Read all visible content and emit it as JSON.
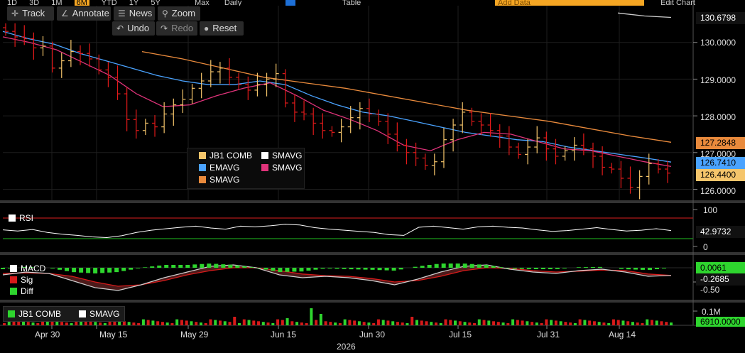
{
  "toolbar": {
    "track": "Track",
    "annotate": "Annotate",
    "news": "News",
    "zoom": "Zoom",
    "undo": "Undo",
    "redo": "Redo",
    "reset": "Reset"
  },
  "top_strip": {
    "periods": [
      "1D",
      "3D",
      "1M",
      "6M",
      "YTD",
      "1Y",
      "5Y",
      "Max",
      "Daily"
    ],
    "table": "Table",
    "add_data": "Add Data",
    "edit_chart": "Edit Chart"
  },
  "colors": {
    "up_bar": "#f5c56b",
    "down_bar": "#e31a1a",
    "ema": "#4aa3ff",
    "sma_pink": "#e0337a",
    "sma_orange": "#e98a3c",
    "sma_white": "#cccccc",
    "rsi_line": "#ffffff",
    "macd_green": "#2ed52e",
    "sig_red": "#d61a1a"
  },
  "chart_data": [
    {
      "type": "candlestick",
      "panel": "price",
      "legend": [
        {
          "name": "JB1 COMB",
          "color": "#f5c56b"
        },
        {
          "name": "SMAVG",
          "color": "#ffffff"
        },
        {
          "name": "EMAVG",
          "color": "#4aa3ff"
        },
        {
          "name": "SMAVG",
          "color": "#e0337a"
        },
        {
          "name": "SMAVG",
          "color": "#e98a3c"
        }
      ],
      "y_ticks": [
        "130.0000",
        "129.0000",
        "128.0000",
        "127.0000",
        "126.0000"
      ],
      "ylim": [
        125.7,
        131.0
      ],
      "last_values": {
        "smavg_white": "130.6798",
        "smavg_orange": "127.2848",
        "emavg": "126.7410",
        "smavg_pink": "126.6205",
        "price": "126.4400"
      },
      "closes": [
        130.3,
        130.15,
        130.1,
        129.85,
        129.9,
        129.3,
        129.5,
        129.75,
        129.7,
        129.55,
        129.25,
        129.05,
        128.6,
        127.9,
        127.6,
        127.8,
        127.7,
        128.05,
        128.3,
        128.45,
        128.75,
        128.95,
        129.2,
        129.3,
        129.05,
        128.85,
        128.7,
        128.85,
        129.0,
        129.15,
        128.35,
        128.1,
        128.05,
        127.8,
        127.6,
        127.55,
        127.7,
        127.95,
        128.2,
        128.05,
        127.85,
        127.5,
        127.2,
        127.0,
        126.85,
        126.65,
        126.75,
        127.35,
        127.75,
        128.1,
        127.85,
        127.75,
        127.6,
        127.45,
        127.15,
        126.95,
        127.15,
        127.4,
        127.1,
        126.9,
        127.05,
        127.2,
        127.1,
        126.9,
        126.6,
        126.55,
        126.3,
        126.05,
        126.35,
        126.7,
        126.55,
        126.44
      ],
      "smavg_white": [
        130.8,
        130.72,
        130.68
      ],
      "emavg": [
        130.3,
        130.1,
        129.95,
        129.7,
        129.5,
        129.3,
        129.1,
        128.95,
        128.85,
        128.85,
        128.95,
        128.85,
        128.55,
        128.3,
        128.1,
        128.0,
        127.85,
        127.7,
        127.55,
        127.45,
        127.35,
        127.3,
        127.15,
        127.05,
        126.95,
        126.85,
        126.74
      ],
      "smavg_pink": [
        130.15,
        130.0,
        129.8,
        129.45,
        129.1,
        128.6,
        128.25,
        128.3,
        128.55,
        128.75,
        128.9,
        128.55,
        128.15,
        127.9,
        127.6,
        127.2,
        127.05,
        127.35,
        127.55,
        127.5,
        127.3,
        127.1,
        127.05,
        126.9,
        126.75,
        126.62
      ],
      "smavg_orange": [
        129.75,
        129.55,
        129.3,
        129.05,
        128.9,
        128.75,
        128.55,
        128.35,
        128.15,
        128.0,
        127.85,
        127.65,
        127.45,
        127.28
      ]
    },
    {
      "type": "line",
      "panel": "RSI",
      "legend": [
        {
          "name": "RSI",
          "color": "#ffffff"
        }
      ],
      "y_ticks": [
        "100",
        "0"
      ],
      "ylim": [
        0,
        100
      ],
      "last_value": "42.9732",
      "values": [
        45,
        42,
        46,
        38,
        33,
        30,
        26,
        24,
        29,
        38,
        44,
        48,
        52,
        55,
        50,
        47,
        55,
        53,
        56,
        60,
        58,
        51,
        47,
        44,
        41,
        38,
        32,
        30,
        52,
        55,
        51,
        47,
        53,
        55,
        52,
        50,
        45,
        41,
        43,
        47,
        51,
        46,
        42,
        44,
        48,
        43
      ]
    },
    {
      "type": "line",
      "panel": "MACD",
      "legend": [
        {
          "name": "MACD",
          "color": "#ffffff"
        },
        {
          "name": "Sig",
          "color": "#d61a1a"
        },
        {
          "name": "Diff",
          "color": "#2ed52e"
        }
      ],
      "y_ticks": [
        "-0.50"
      ],
      "last_values": {
        "diff": "0.0061",
        "macd": "-0.2685"
      },
      "macd": [
        -0.25,
        -0.15,
        -0.2,
        -0.45,
        -0.7,
        -0.8,
        -0.6,
        -0.35,
        -0.15,
        0.05,
        0.1,
        0.0,
        -0.25,
        -0.35,
        -0.3,
        -0.35,
        -0.45,
        -0.6,
        -0.4,
        -0.15,
        0.05,
        0.1,
        -0.05,
        -0.15,
        -0.2,
        -0.1,
        -0.05,
        -0.15,
        -0.3,
        -0.27
      ],
      "sig": [
        -0.2,
        -0.18,
        -0.2,
        -0.3,
        -0.5,
        -0.65,
        -0.6,
        -0.45,
        -0.25,
        -0.1,
        0.0,
        0.0,
        -0.1,
        -0.22,
        -0.28,
        -0.3,
        -0.38,
        -0.5,
        -0.45,
        -0.3,
        -0.1,
        0.0,
        -0.02,
        -0.1,
        -0.15,
        -0.12,
        -0.08,
        -0.1,
        -0.22,
        -0.27
      ]
    },
    {
      "type": "bar",
      "panel": "volume",
      "legend": [
        {
          "name": "JB1 COMB",
          "color": "#2ed52e"
        },
        {
          "name": "SMAVG",
          "color": "#ffffff"
        }
      ],
      "y_ticks": [
        "0.1M"
      ],
      "last_value": "6910.0000"
    }
  ],
  "x_axis": {
    "ticks": [
      "Apr 30",
      "May 15",
      "May 29",
      "Jun 15",
      "Jun 30",
      "Jul 15",
      "Jul 31",
      "Aug 14"
    ],
    "year": "2026"
  }
}
